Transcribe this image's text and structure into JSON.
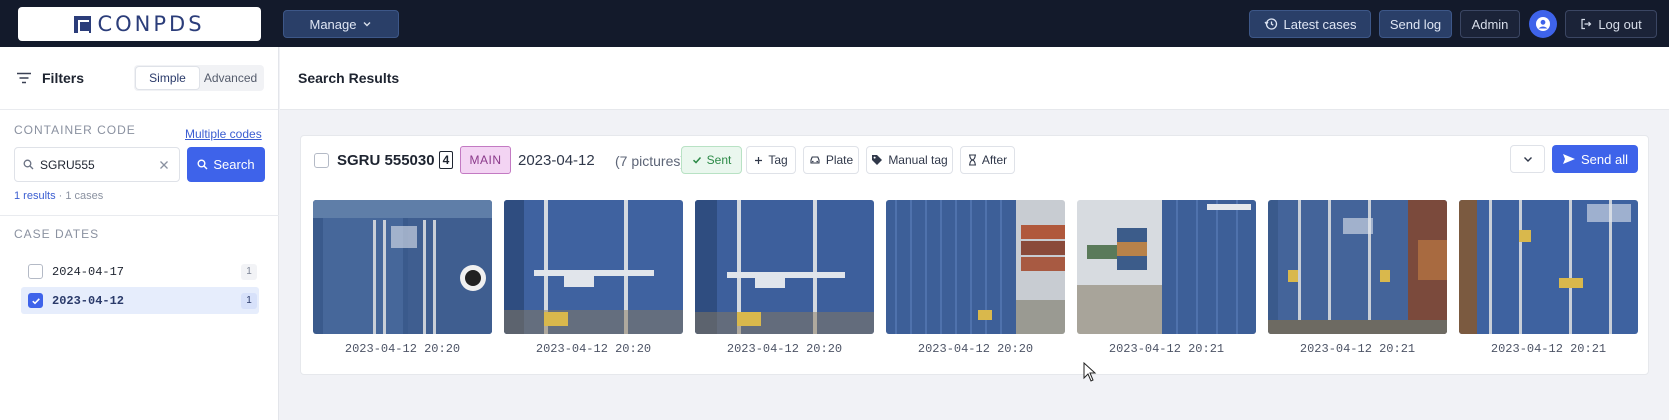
{
  "app": {
    "logo_text": "CONPDS",
    "colors": {
      "nav_bg": "#131a2b",
      "accent": "#3e63ea",
      "selected_bg": "#e6edfc",
      "main_badge": "#f3d4f3",
      "sent": "#2c8a47"
    }
  },
  "topbar": {
    "manage_label": "Manage",
    "latest_cases_label": "Latest cases",
    "send_log_label": "Send log",
    "admin_label": "Admin",
    "logout_label": "Log out"
  },
  "sidebar": {
    "title": "Filters",
    "tabs": [
      "Simple",
      "Advanced"
    ],
    "active_tab": "Simple",
    "container_code_label": "CONTAINER CODE",
    "multiple_codes_link": "Multiple codes",
    "search_value": "SGRU555",
    "search_button": "Search",
    "results_count": "1 results",
    "results_cases": "· 1 cases",
    "case_dates_label": "CASE DATES",
    "dates": [
      {
        "label": "2024-04-17",
        "count": "1",
        "checked": false
      },
      {
        "label": "2023-04-12",
        "count": "1",
        "checked": true
      }
    ]
  },
  "main": {
    "title": "Search Results",
    "case": {
      "code": "SGRU 555030",
      "check_digit": "4",
      "badge": "MAIN",
      "date": "2023-04-12",
      "pictures": "(7 pictures)",
      "chips": [
        "Sent",
        "Tag",
        "Plate",
        "Manual tag",
        "After"
      ],
      "send_all_label": "Send all",
      "photos": [
        {
          "timestamp": "2023-04-12 20:20",
          "icon": "container-door-photo"
        },
        {
          "timestamp": "2023-04-12 20:20",
          "icon": "container-door-photo"
        },
        {
          "timestamp": "2023-04-12 20:20",
          "icon": "container-door-photo"
        },
        {
          "timestamp": "2023-04-12 20:20",
          "icon": "container-side-photo"
        },
        {
          "timestamp": "2023-04-12 20:21",
          "icon": "container-yard-photo"
        },
        {
          "timestamp": "2023-04-12 20:21",
          "icon": "container-door-photo"
        },
        {
          "timestamp": "2023-04-12 20:21",
          "icon": "container-door-photo"
        }
      ]
    }
  }
}
